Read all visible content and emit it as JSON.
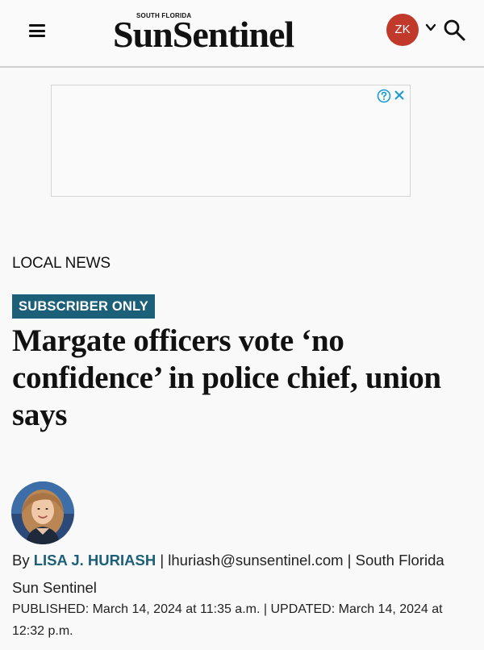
{
  "header": {
    "logo_small": "SOUTH FLORIDA",
    "logo_main": "SunSentinel",
    "user_initials": "ZK",
    "user_avatar_color": "#c0392b"
  },
  "ad": {
    "info_icon": "question-circle-icon",
    "close_icon": "close-icon"
  },
  "article": {
    "section": "LOCAL NEWS",
    "badge": "SUBSCRIBER ONLY",
    "badge_color": "#1c5f79",
    "headline": "Margate officers vote ‘no confidence’ in police chief, union says",
    "byline": {
      "prefix": "By",
      "author": "LISA J. HURIASH",
      "email": "lhuriash@sunsentinel.com",
      "publication": "South Florida Sun Sentinel"
    },
    "published_label": "PUBLISHED:",
    "published": "March 14, 2024 at 11:35 a.m.",
    "updated_label": "UPDATED:",
    "updated": "March 14, 2024 at 12:32 p.m."
  }
}
